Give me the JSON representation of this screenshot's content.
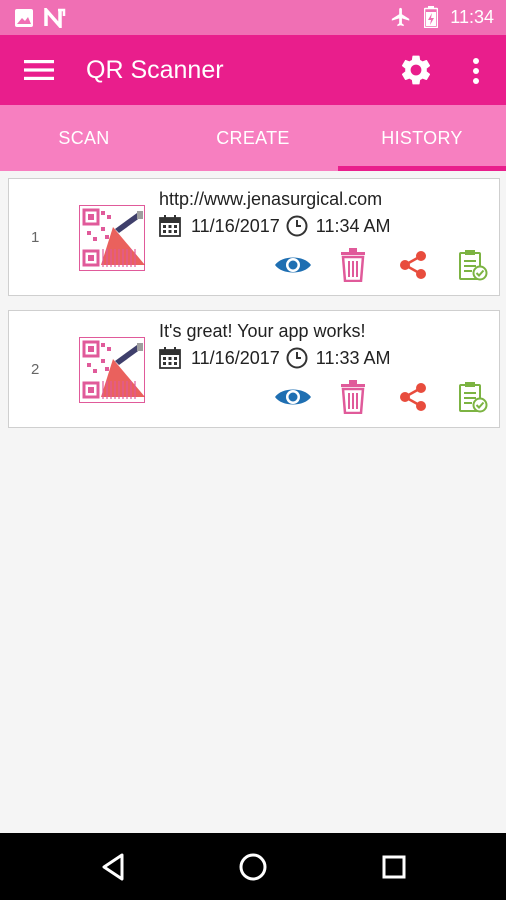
{
  "status_bar": {
    "time": "11:34",
    "icons": [
      "image-icon",
      "n-icon",
      "airplane-icon",
      "battery-icon"
    ]
  },
  "app_bar": {
    "title": "QR Scanner",
    "icons": [
      "menu-icon",
      "settings-icon",
      "more-vert-icon"
    ]
  },
  "tabs": [
    {
      "label": "SCAN"
    },
    {
      "label": "CREATE"
    },
    {
      "label": "HISTORY",
      "selected": true
    }
  ],
  "history": [
    {
      "index": "1",
      "text": "http://www.jenasurgical.com",
      "date": "11/16/2017",
      "time": "11:34 AM"
    },
    {
      "index": "2",
      "text": "It's great! Your app works!",
      "date": "11/16/2017",
      "time": "11:33 AM"
    }
  ],
  "actions": [
    "view-icon",
    "delete-icon",
    "share-icon",
    "copy-icon"
  ],
  "colors": {
    "primary": "#e91e8c",
    "status_bar": "#f06fb4",
    "tab_bar": "#f77fc0",
    "view": "#1f6fb2",
    "delete": "#e05a9a",
    "share": "#e84c3d",
    "copy": "#7cb342"
  }
}
